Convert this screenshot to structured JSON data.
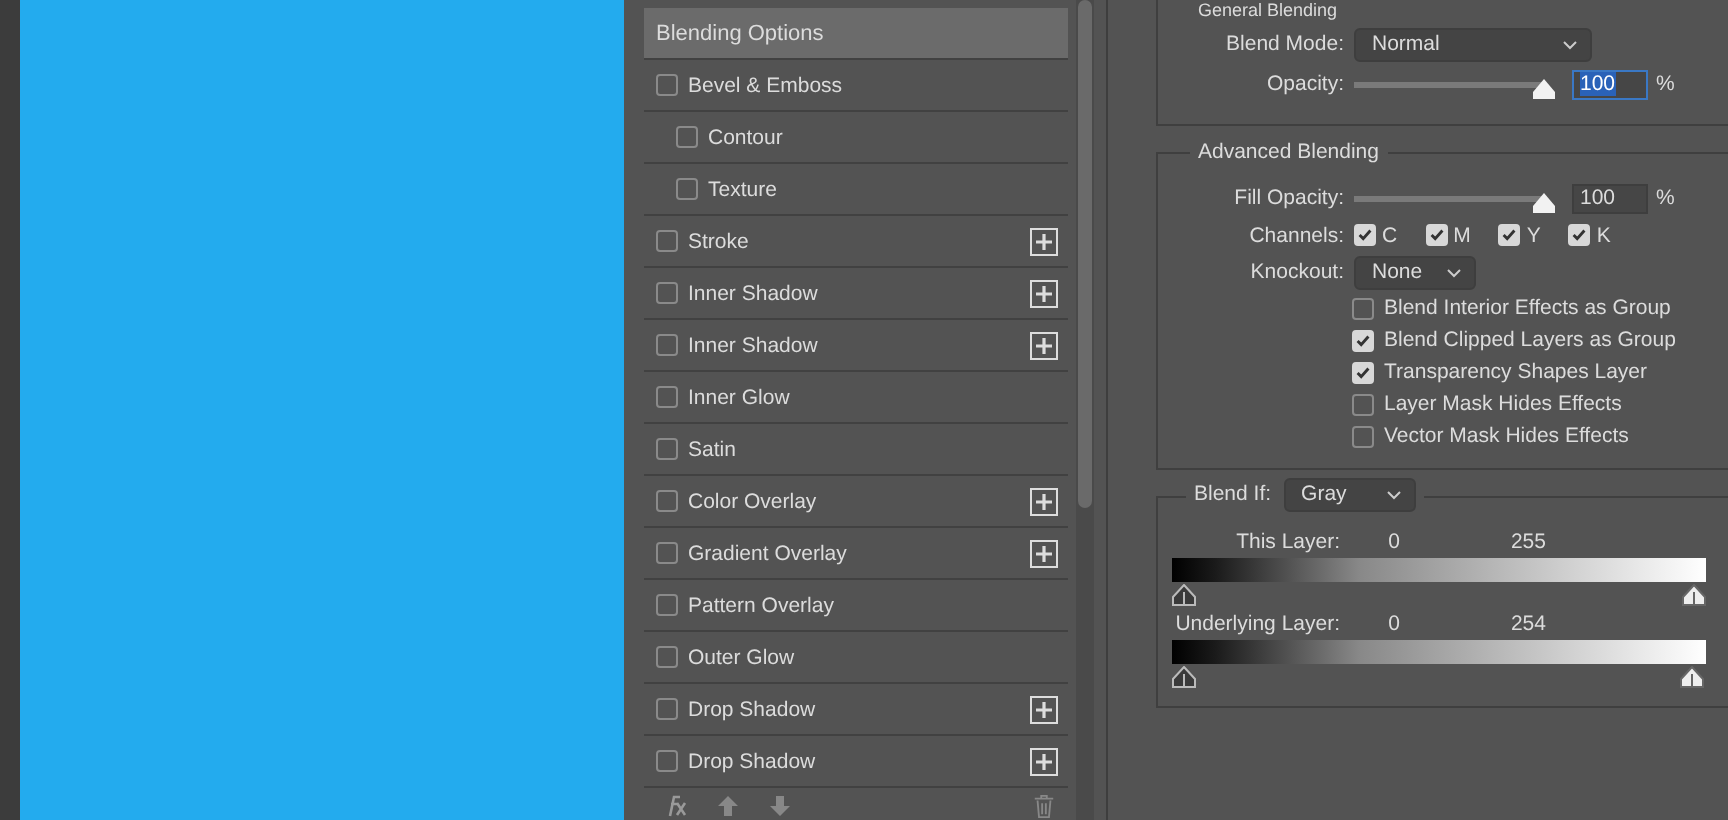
{
  "styles": [
    {
      "label": "Blending Options",
      "kind": "header",
      "selected": true
    },
    {
      "label": "Bevel & Emboss",
      "kind": "effect",
      "checked": false,
      "selected": false,
      "add_button": false,
      "children": [
        {
          "label": "Contour",
          "kind": "effect",
          "checked": false,
          "selected": false,
          "add_button": false
        },
        {
          "label": "Texture",
          "kind": "effect",
          "checked": false,
          "selected": false,
          "add_button": false
        }
      ]
    },
    {
      "label": "Stroke",
      "kind": "effect",
      "checked": false,
      "selected": false,
      "add_button": true
    },
    {
      "label": "Inner Shadow",
      "kind": "effect",
      "checked": false,
      "selected": false,
      "add_button": true
    },
    {
      "label": "Inner Shadow",
      "kind": "effect",
      "checked": false,
      "selected": false,
      "add_button": true
    },
    {
      "label": "Inner Glow",
      "kind": "effect",
      "checked": false,
      "selected": false,
      "add_button": false
    },
    {
      "label": "Satin",
      "kind": "effect",
      "checked": false,
      "selected": false,
      "add_button": false
    },
    {
      "label": "Color Overlay",
      "kind": "effect",
      "checked": false,
      "selected": false,
      "add_button": true
    },
    {
      "label": "Gradient Overlay",
      "kind": "effect",
      "checked": false,
      "selected": false,
      "add_button": true
    },
    {
      "label": "Pattern Overlay",
      "kind": "effect",
      "checked": false,
      "selected": false,
      "add_button": false
    },
    {
      "label": "Outer Glow",
      "kind": "effect",
      "checked": false,
      "selected": false,
      "add_button": false
    },
    {
      "label": "Drop Shadow",
      "kind": "effect",
      "checked": false,
      "selected": false,
      "add_button": true
    },
    {
      "label": "Drop Shadow",
      "kind": "effect",
      "checked": false,
      "selected": false,
      "add_button": true
    }
  ],
  "general_blending": {
    "title": "General Blending",
    "blend_mode_label": "Blend Mode:",
    "blend_mode": "Normal",
    "opacity_label": "Opacity:",
    "opacity": {
      "level": 1
    },
    "opacity_value": "100",
    "opacity_value_selected": true,
    "opacity_unit": "%"
  },
  "advanced_blending": {
    "title": "Advanced Blending",
    "fill_opacity_label": "Fill Opacity:",
    "fill_opacity": {
      "level": 1
    },
    "fill_opacity_value": "100",
    "fill_opacity_unit": "%",
    "channels_label": "Channels:",
    "channels": [
      {
        "label": "C",
        "checked": true
      },
      {
        "label": "M",
        "checked": true
      },
      {
        "label": "Y",
        "checked": true
      },
      {
        "label": "K",
        "checked": true
      }
    ],
    "knockout_label": "Knockout:",
    "knockout": "None",
    "options": [
      {
        "label": "Blend Interior Effects as Group",
        "checked": false
      },
      {
        "label": "Blend Clipped Layers as Group",
        "checked": true
      },
      {
        "label": "Transparency Shapes Layer",
        "checked": true
      },
      {
        "label": "Layer Mask Hides Effects",
        "checked": false
      },
      {
        "label": "Vector Mask Hides Effects",
        "checked": false
      }
    ]
  },
  "blend_if": {
    "label": "Blend If:",
    "channel": "Gray",
    "layers": [
      {
        "label": "This Layer:",
        "low": "0",
        "high": "255",
        "low_thumb": {
          "level": 0
        },
        "high_thumb": {
          "level": 1
        }
      },
      {
        "label": "Underlying Layer:",
        "low": "0",
        "high": "254",
        "low_thumb": {
          "level": 0
        },
        "high_thumb": {
          "level": 0.996
        }
      }
    ]
  }
}
